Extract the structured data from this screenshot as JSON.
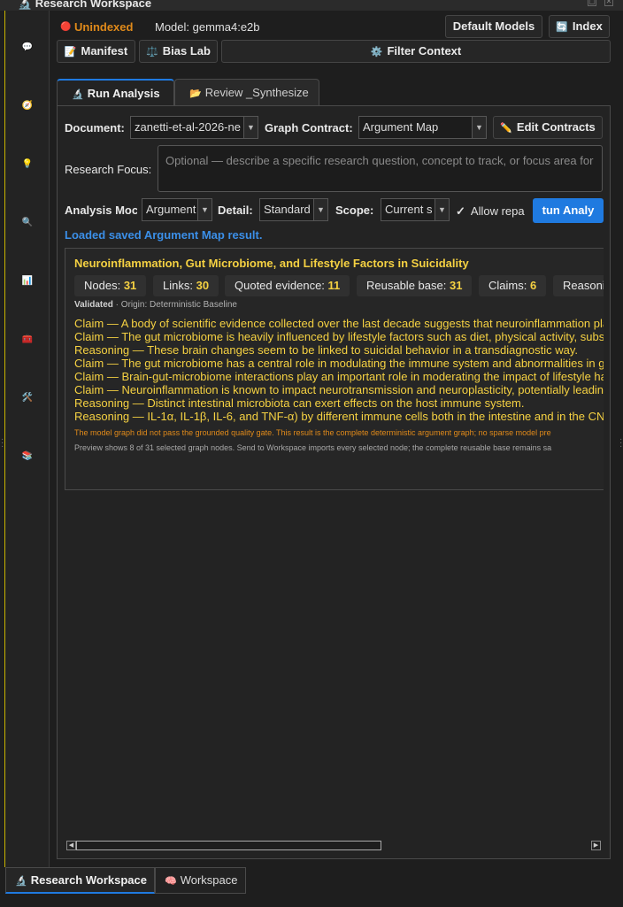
{
  "window": {
    "title": "🔬 Research Workspace"
  },
  "sidebar": {
    "icons": [
      "💬",
      "🧭",
      "💡",
      "🔍",
      "📊",
      "🧰",
      "🛠️",
      "📚"
    ]
  },
  "toolbar": {
    "status_dot": "🔴",
    "status": "Unindexed",
    "model": "Model: gemma4:e2b",
    "default_models": "Default Models",
    "index_icon": "🔄",
    "index": "Index",
    "manifest_icon": "📝",
    "manifest": "Manifest",
    "bias_icon": "⚖️",
    "bias_lab": "Bias Lab",
    "filter_icon": "⚙️",
    "filter_context": "Filter Context"
  },
  "tabs": {
    "run_icon": "🔬",
    "run": "Run Analysis",
    "review_icon": "📂",
    "review": "Review _Synthesize"
  },
  "form": {
    "document_label": "Document:",
    "document_value": "zanetti-et-al-2026-ne",
    "graph_contract_label": "Graph Contract:",
    "graph_contract_value": "Argument Map",
    "edit_contracts_icon": "✏️",
    "edit_contracts": "Edit Contracts",
    "research_focus_label": "Research Focus:",
    "research_focus_placeholder": "Optional — describe a specific research question, concept to track, or focus area for",
    "analysis_mode_label": "Analysis Moc",
    "analysis_mode_value": "Argument",
    "detail_label": "Detail:",
    "detail_value": "Standard",
    "scope_label": "Scope:",
    "scope_value": "Current s",
    "allow_repair_check": "✓",
    "allow_repair": "Allow repa",
    "run_button": "tun Analy"
  },
  "loaded_message": "Loaded saved Argument Map result.",
  "result": {
    "title": "Neuroinflammation, Gut Microbiome, and Lifestyle Factors in Suicidality",
    "stats": [
      {
        "label": "Nodes:",
        "value": "31"
      },
      {
        "label": "Links:",
        "value": "30"
      },
      {
        "label": "Quoted evidence:",
        "value": "11"
      },
      {
        "label": "Reusable base:",
        "value": "31"
      },
      {
        "label": "Claims:",
        "value": "6"
      },
      {
        "label": "Reasoni",
        "value": ""
      }
    ],
    "validated": "Validated",
    "origin": " · Origin: Deterministic Baseline",
    "lines": [
      "Claim — A body of scientific evidence collected over the last decade suggests that neuroinflammation pla",
      "Claim — The gut microbiome is heavily influenced by lifestyle factors such as diet, physical activity, subs",
      "Reasoning — These brain changes seem to be linked to suicidal behavior in a transdiagnostic way.",
      "Claim — The gut microbiome has a central role in modulating the immune system and abnormalities in g",
      "Claim — Brain-gut-microbiome interactions play an important role in moderating the impact of lifestyle ha",
      "Claim — Neuroinflammation is known to impact neurotransmission and neuroplasticity, potentially leadin",
      "Reasoning — Distinct intestinal microbiota can exert effects on the host immune system.",
      "Reasoning — IL-1α, IL-1β, IL-6, and TNF-α) by different immune cells both in the intestine and in the CN"
    ],
    "warning": "The model graph did not pass the grounded quality gate. This result is the complete deterministic argument graph; no sparse model pre",
    "note": "Preview shows 8 of 31 selected graph nodes. Send to Workspace imports every selected node; the complete reusable base remains sa"
  },
  "bottom_tabs": {
    "research_icon": "🔬",
    "research": "Research Workspace",
    "workspace_icon": "🧠",
    "workspace": "Workspace"
  },
  "colors": {
    "accent": "#1f7ae0",
    "highlight": "#f5d142",
    "warning": "#e08a1a",
    "status": "#e08a1a"
  }
}
